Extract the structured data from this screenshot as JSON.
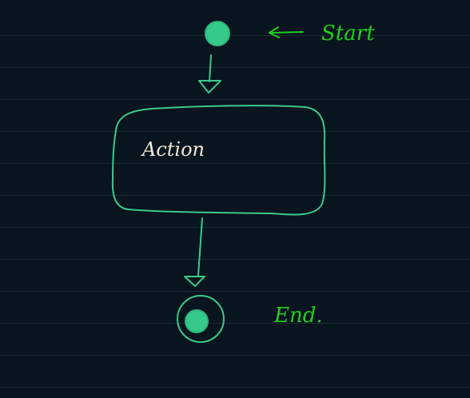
{
  "diagram": {
    "start_label": "Start",
    "action_label": "Action",
    "end_label": "End."
  },
  "colors": {
    "background": "#08141e",
    "grid_line": "#1b2a35",
    "node_stroke": "#3cc98a",
    "node_fill": "#35c98a",
    "label_green": "#22cc22",
    "action_text": "#f2ead8"
  }
}
